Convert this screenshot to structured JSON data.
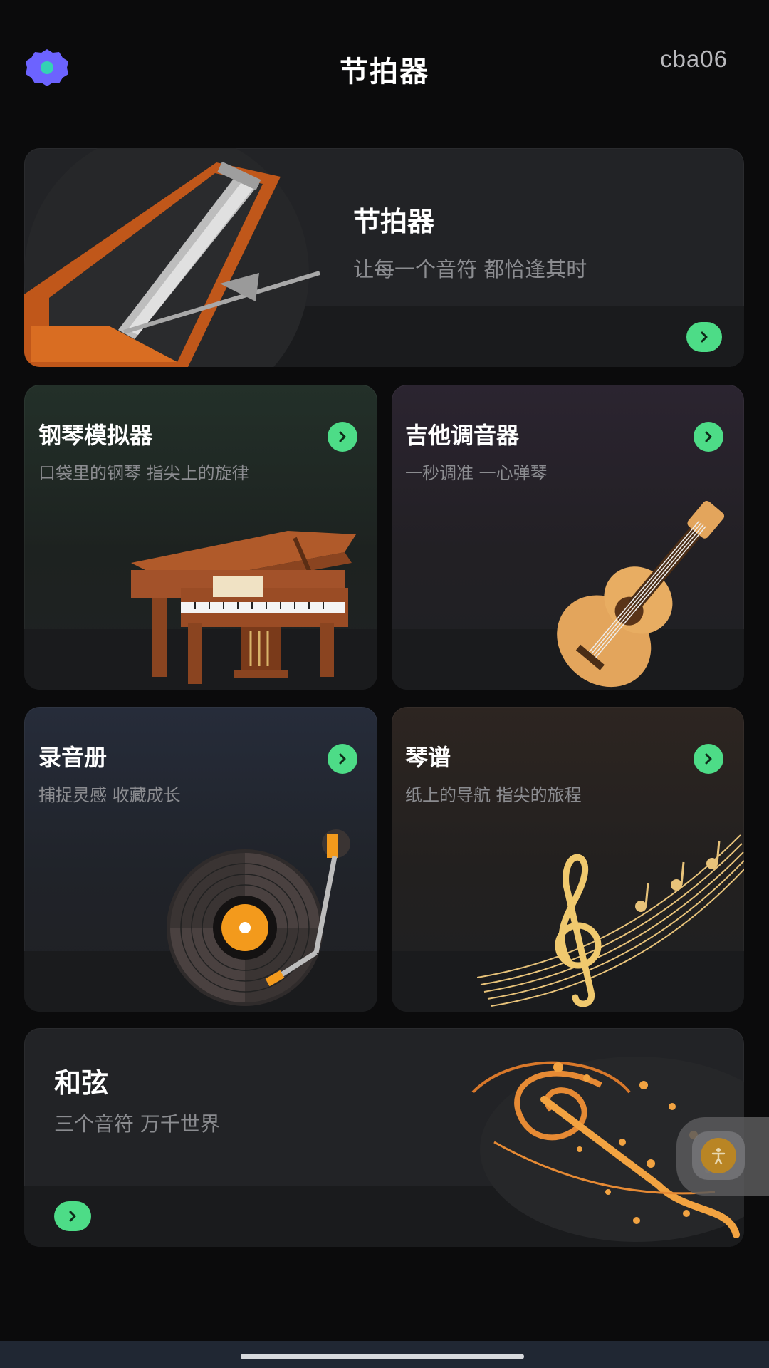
{
  "header": {
    "title": "节拍器",
    "user_id": "cba06",
    "settings_icon": "gear-icon",
    "accent": "#6c63ff"
  },
  "cards": {
    "metronome": {
      "title": "节拍器",
      "subtitle": "让每一个音符 都恰逢其时",
      "icon": "metronome-illustration"
    },
    "piano": {
      "title": "钢琴模拟器",
      "subtitle": "口袋里的钢琴 指尖上的旋律",
      "icon": "grand-piano-illustration"
    },
    "guitar": {
      "title": "吉他调音器",
      "subtitle": "一秒调准 一心弹琴",
      "icon": "guitar-illustration"
    },
    "recorder": {
      "title": "录音册",
      "subtitle": "捕捉灵感 收藏成长",
      "icon": "turntable-illustration"
    },
    "score": {
      "title": "琴谱",
      "subtitle": "纸上的导航 指尖的旅程",
      "icon": "treble-clef-illustration"
    },
    "chord": {
      "title": "和弦",
      "subtitle": "三个音符 万千世界",
      "icon": "music-notes-illustration"
    }
  },
  "colors": {
    "go_button": "#4ddc87",
    "background": "#0b0b0c",
    "card": "#222326"
  },
  "floating_button": {
    "icon": "accessibility-icon"
  }
}
